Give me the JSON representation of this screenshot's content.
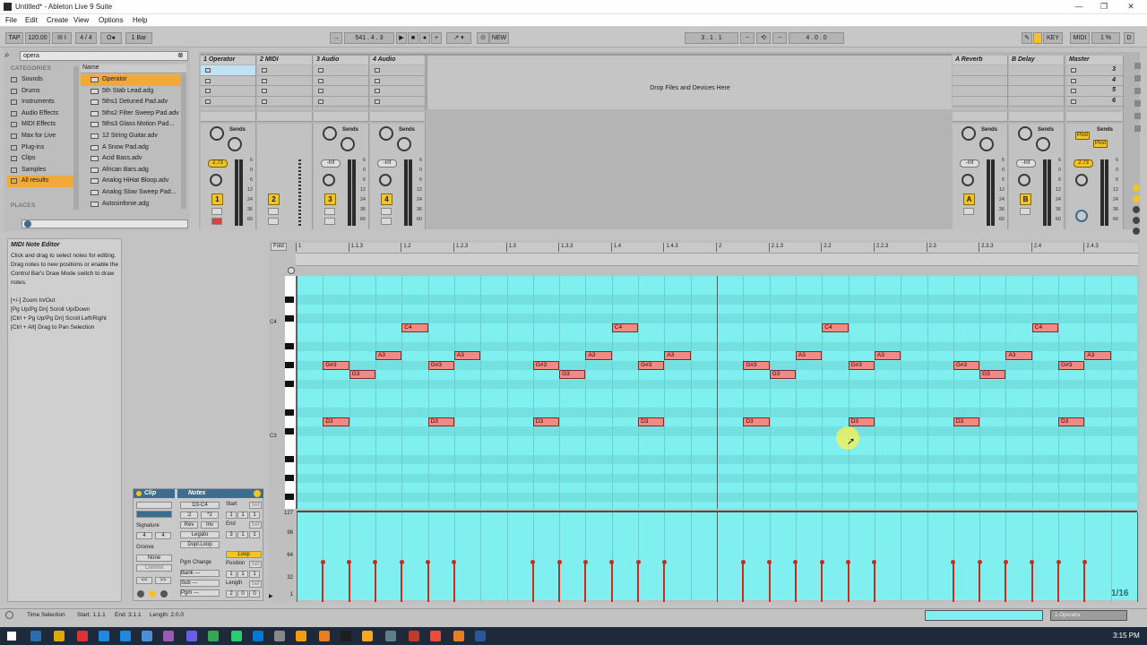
{
  "window": {
    "title": "Untitled* - Ableton Live 9 Suite",
    "min": "—",
    "max": "❐",
    "close": "✕"
  },
  "menu": [
    "File",
    "Edit",
    "Create",
    "View",
    "Options",
    "Help"
  ],
  "control_bar": {
    "tap": "TAP",
    "tempo": "120.00",
    "tempo_nudge": "III I",
    "signature": "4 / 4",
    "metronome": "O●",
    "quantize": "1 Bar",
    "position": "541 . 4 . 3",
    "new": "NEW",
    "loop_start": "3 . 1 . 1",
    "loop_length": "4 . 0 . 0",
    "key": "KEY",
    "midi": "MIDI",
    "cpu": "1 %",
    "d": "D"
  },
  "browser": {
    "search_value": "opera",
    "categories_header": "CATEGORIES",
    "name_header": "Name",
    "categories": [
      {
        "label": "Sounds",
        "icon": "note-icon"
      },
      {
        "label": "Drums",
        "icon": "drum-icon"
      },
      {
        "label": "Instruments",
        "icon": "instrument-icon"
      },
      {
        "label": "Audio Effects",
        "icon": "audio-effect-icon"
      },
      {
        "label": "MIDI Effects",
        "icon": "midi-effect-icon"
      },
      {
        "label": "Max for Live",
        "icon": "max-icon"
      },
      {
        "label": "Plug-ins",
        "icon": "plugin-icon"
      },
      {
        "label": "Clips",
        "icon": "clip-icon"
      },
      {
        "label": "Samples",
        "icon": "sample-icon"
      },
      {
        "label": "All results",
        "icon": "search-icon"
      }
    ],
    "selected_category": "All results",
    "places_header": "PLACES",
    "items": [
      "Operator",
      "5th Stab Lead.adg",
      "5ths1 Detuned Pad.adv",
      "5ths2 Filter Sweep Pad.adv",
      "5ths3 Glass Motion Pad...",
      "12 String Guitar.adv",
      "A Snow Pad.adg",
      "Acid Bass.adv",
      "African Bars.adg",
      "Analog HiHat Bloop.adv",
      "Analog Slow Sweep Pad...",
      "Autosinfonie.adg"
    ]
  },
  "session": {
    "tracks": [
      {
        "name": "1 Operator",
        "num": "1",
        "vol": "2.73"
      },
      {
        "name": "2 MIDI",
        "num": "2",
        "vol": ""
      },
      {
        "name": "3 Audio",
        "num": "3",
        "vol": "-Inf"
      },
      {
        "name": "4 Audio",
        "num": "4",
        "vol": "-Inf"
      }
    ],
    "drop_text": "Drop Files and Devices Here",
    "returns": [
      {
        "name": "A Reverb",
        "num": "A",
        "vol": "-Inf"
      },
      {
        "name": "B Delay",
        "num": "B",
        "vol": "-Inf"
      }
    ],
    "master": {
      "name": "Master",
      "vol": "2.73",
      "scenes": [
        "3",
        "4",
        "5",
        "6"
      ],
      "post": "Post"
    },
    "sends_label": "Sends",
    "scale": [
      "6",
      "0",
      "6",
      "12",
      "24",
      "36",
      "60"
    ]
  },
  "info_view": {
    "title": "MIDI Note Editor",
    "body": "Click and drag to select notes for editing. Drag notes to new positions or enable the Control Bar's Draw Mode switch to draw notes.",
    "shortcuts": [
      "[+/-] Zoom In/Out",
      "[Pg Up/Pg Dn] Scroll Up/Down",
      "[Ctrl + Pg Up/Pg Dn] Scroll Left/Right",
      "[Ctrl + Alt] Drag to Pan Selection"
    ]
  },
  "clip_panel": {
    "clip_title": "Clip",
    "notes_title": "Notes",
    "range": "D3-C4",
    "signature_label": "Signature",
    "sig_num": "4",
    "sig_den": "4",
    "groove_label": "Groove",
    "groove_value": "None",
    "commit": "Commit",
    "start_label": "Start",
    "end_label": "End",
    "set": "Set",
    "start": [
      "1",
      "1",
      "1"
    ],
    "end": [
      "3",
      "1",
      "1"
    ],
    "btn_div2": ":2",
    "btn_mul2": "*2",
    "rev": "Rev",
    "inv": "Inv",
    "legato": "Legato",
    "dupl_loop": "Dupl.Loop",
    "loop": "Loop",
    "position_label": "Position",
    "length_label": "Length",
    "position": [
      "1",
      "1",
      "1"
    ],
    "length": [
      "2",
      "0",
      "0"
    ],
    "pgm_change": "Pgm Change",
    "bank": "Bank ---",
    "sub": "Sub ---",
    "pgm": "Pgm ---"
  },
  "piano_roll": {
    "fold": "Fold",
    "ruler": [
      "1",
      "1.1.3",
      "1.2",
      "1.2.3",
      "1.3",
      "1.3.3",
      "1.4",
      "1.4.3",
      "2",
      "2.1.3",
      "2.2",
      "2.2.3",
      "2.3",
      "2.3.3",
      "2.4",
      "2.4.3"
    ],
    "pitch_labels": [
      "C4",
      "C3"
    ],
    "velocity_labels": [
      "127",
      "96",
      "64",
      "32",
      "1"
    ],
    "grid": "1/16",
    "notes": [
      {
        "pitch": "G#3",
        "start": 0.25,
        "len": 0.25
      },
      {
        "pitch": "G3",
        "start": 0.5,
        "len": 0.25
      },
      {
        "pitch": "A3",
        "start": 0.75,
        "len": 0.25
      },
      {
        "pitch": "C4",
        "start": 1.0,
        "len": 0.25
      },
      {
        "pitch": "G#3",
        "start": 1.25,
        "len": 0.25
      },
      {
        "pitch": "A3",
        "start": 1.5,
        "len": 0.25
      },
      {
        "pitch": "D3",
        "start": 0.25,
        "len": 0.25
      },
      {
        "pitch": "D3",
        "start": 1.25,
        "len": 0.25
      },
      {
        "pitch": "G#3",
        "start": 2.25,
        "len": 0.25
      },
      {
        "pitch": "G3",
        "start": 2.5,
        "len": 0.25
      },
      {
        "pitch": "A3",
        "start": 2.75,
        "len": 0.25
      },
      {
        "pitch": "C4",
        "start": 3.0,
        "len": 0.25
      },
      {
        "pitch": "G#3",
        "start": 3.25,
        "len": 0.25
      },
      {
        "pitch": "A3",
        "start": 3.5,
        "len": 0.25
      },
      {
        "pitch": "D3",
        "start": 2.25,
        "len": 0.25
      },
      {
        "pitch": "D3",
        "start": 3.25,
        "len": 0.25
      },
      {
        "pitch": "G#3",
        "start": 4.25,
        "len": 0.25
      },
      {
        "pitch": "G3",
        "start": 4.5,
        "len": 0.25
      },
      {
        "pitch": "A3",
        "start": 4.75,
        "len": 0.25
      },
      {
        "pitch": "C4",
        "start": 5.0,
        "len": 0.25
      },
      {
        "pitch": "G#3",
        "start": 5.25,
        "len": 0.25
      },
      {
        "pitch": "A3",
        "start": 5.5,
        "len": 0.25
      },
      {
        "pitch": "D3",
        "start": 4.25,
        "len": 0.25
      },
      {
        "pitch": "D3",
        "start": 5.25,
        "len": 0.25
      },
      {
        "pitch": "G#3",
        "start": 6.25,
        "len": 0.25
      },
      {
        "pitch": "G3",
        "start": 6.5,
        "len": 0.25
      },
      {
        "pitch": "A3",
        "start": 6.75,
        "len": 0.25
      },
      {
        "pitch": "C4",
        "start": 7.0,
        "len": 0.25
      },
      {
        "pitch": "G#3",
        "start": 7.25,
        "len": 0.25
      },
      {
        "pitch": "A3",
        "start": 7.5,
        "len": 0.25
      },
      {
        "pitch": "D3",
        "start": 6.25,
        "len": 0.25
      },
      {
        "pitch": "D3",
        "start": 7.25,
        "len": 0.25
      }
    ],
    "velocities": [
      0.25,
      0.5,
      0.75,
      1.0,
      1.25,
      1.5,
      2.25,
      2.5,
      2.75,
      3.0,
      3.25,
      3.5,
      4.25,
      4.5,
      4.75,
      5.0,
      5.25,
      5.5,
      6.25,
      6.5,
      6.75,
      7.0,
      7.25,
      7.5
    ]
  },
  "status": {
    "text": "Time Selection",
    "start": "Start: 1.1.1",
    "end": "End: 3.1.1",
    "length": "Length: 2.0.0",
    "track": "1-Operator"
  },
  "taskbar": {
    "clock": "3:15 PM"
  }
}
